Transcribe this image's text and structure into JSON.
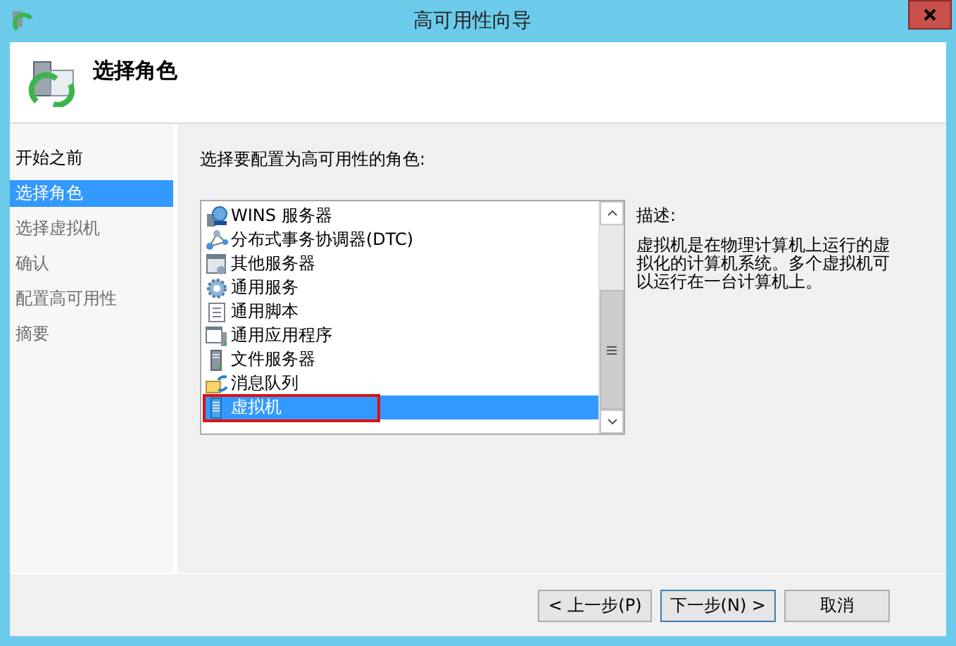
{
  "window": {
    "title": "高可用性向导"
  },
  "header": {
    "title": "选择角色"
  },
  "steps": [
    {
      "label": "开始之前",
      "selected": false,
      "disabled": false
    },
    {
      "label": "选择角色",
      "selected": true,
      "disabled": false
    },
    {
      "label": "选择虚拟机",
      "selected": false,
      "disabled": true
    },
    {
      "label": "确认",
      "selected": false,
      "disabled": true
    },
    {
      "label": "配置高可用性",
      "selected": false,
      "disabled": true
    },
    {
      "label": "摘要",
      "selected": false,
      "disabled": true
    }
  ],
  "prompt": "选择要配置为高可用性的角色:",
  "roles": [
    {
      "label": "WINS 服务器",
      "kind": "wins",
      "selected": false
    },
    {
      "label": "分布式事务协调器(DTC)",
      "kind": "dtc",
      "selected": false
    },
    {
      "label": "其他服务器",
      "kind": "other",
      "selected": false
    },
    {
      "label": "通用服务",
      "kind": "service",
      "selected": false
    },
    {
      "label": "通用脚本",
      "kind": "script",
      "selected": false
    },
    {
      "label": "通用应用程序",
      "kind": "app",
      "selected": false
    },
    {
      "label": "文件服务器",
      "kind": "file",
      "selected": false
    },
    {
      "label": "消息队列",
      "kind": "queue",
      "selected": false
    },
    {
      "label": "虚拟机",
      "kind": "vm",
      "selected": true
    }
  ],
  "description": {
    "label": "描述:",
    "text": "虚拟机是在物理计算机上运行的虚拟化的计算机系统。多个虚拟机可以运行在一台计算机上。"
  },
  "buttons": [
    "< 上一步(P)",
    "下一步(N) >",
    "取消"
  ]
}
